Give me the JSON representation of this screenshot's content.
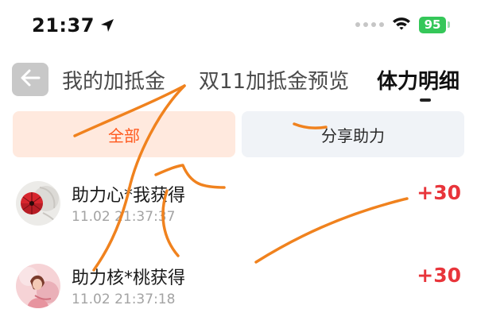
{
  "status_bar": {
    "time": "21:37",
    "battery": "95"
  },
  "header": {
    "back_icon": "arrow-left-icon",
    "tabs": [
      {
        "label": "我的加抵金",
        "active": false
      },
      {
        "label": "双11加抵金预览",
        "active": false
      },
      {
        "label": "体力明细",
        "active": true
      }
    ]
  },
  "filters": {
    "all": "全部",
    "share": "分享助力",
    "selected": "全部"
  },
  "records": [
    {
      "title": "助力心*我获得",
      "time": "11.02 21:37:37",
      "amount": "+30"
    },
    {
      "title": "助力核*桃获得",
      "time": "11.02 21:37:18",
      "amount": "+30"
    }
  ],
  "colors": {
    "accent": "#ff5a1f",
    "accent_bg": "#ffe9de",
    "amount": "#e8353b",
    "battery": "#35c759",
    "annotation": "#f0821e"
  }
}
